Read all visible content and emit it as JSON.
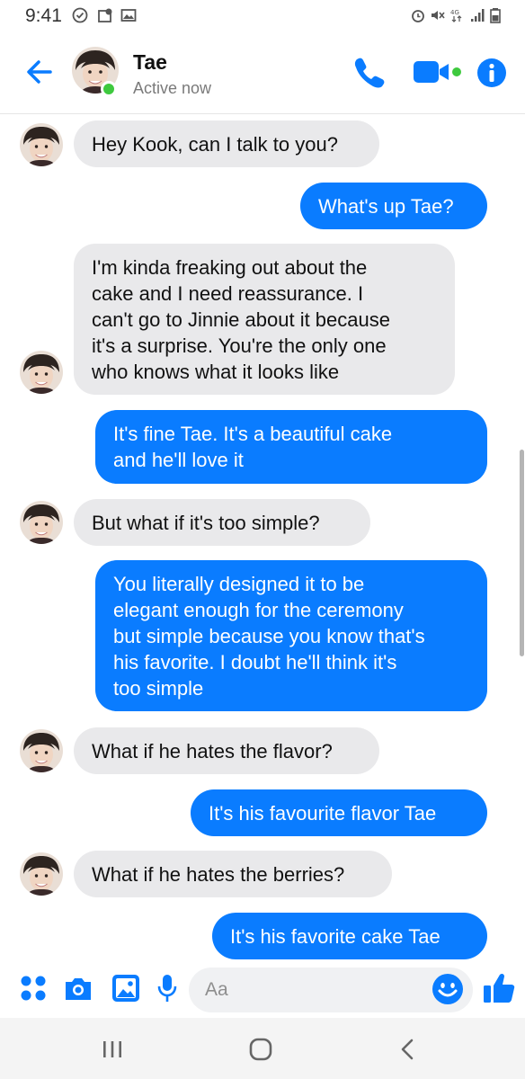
{
  "status_bar": {
    "time": "9:41",
    "icons": [
      "shield-check-icon",
      "location-tag-icon",
      "image-icon",
      "alarm-icon",
      "mute-icon",
      "data-4g-icon",
      "signal-icon",
      "battery-icon"
    ]
  },
  "header": {
    "contact_name": "Tae",
    "status": "Active now",
    "icons": [
      "back-arrow-icon",
      "phone-icon",
      "video-camera-icon",
      "info-icon"
    ],
    "accent_color": "#0a7cff",
    "online_color": "#3ec93e"
  },
  "messages": [
    {
      "from": "Tae",
      "direction": "incoming",
      "text": "Hey Kook, can I talk to you?"
    },
    {
      "from": "me",
      "direction": "outgoing",
      "text": "What's up Tae?"
    },
    {
      "from": "Tae",
      "direction": "incoming",
      "lines": [
        "I'm kinda freaking out about the",
        "cake and I need reassurance. I",
        "can't go to Jinnie about it because",
        "it's a surprise.  You're the only one",
        "who knows what it looks like"
      ]
    },
    {
      "from": "me",
      "direction": "outgoing",
      "lines": [
        "It's fine Tae. It's a beautiful cake",
        "and he'll love it"
      ]
    },
    {
      "from": "Tae",
      "direction": "incoming",
      "text": "But what if it's too simple?"
    },
    {
      "from": "me",
      "direction": "outgoing",
      "lines": [
        "You literally designed it to be",
        "elegant enough for the ceremony",
        "but simple because you know that's",
        "his favorite. I doubt he'll think it's",
        "too simple"
      ]
    },
    {
      "from": "Tae",
      "direction": "incoming",
      "text": "What if he hates the flavor?"
    },
    {
      "from": "me",
      "direction": "outgoing",
      "text": "It's his favourite flavor Tae"
    },
    {
      "from": "Tae",
      "direction": "incoming",
      "text": "What if he hates the berries?"
    },
    {
      "from": "me",
      "direction": "outgoing",
      "text": "It's his favorite cake Tae"
    }
  ],
  "composer": {
    "placeholder": "Aa",
    "icons": [
      "more-apps-icon",
      "camera-icon",
      "gallery-icon",
      "microphone-icon",
      "emoji-icon",
      "thumbs-up-icon"
    ]
  },
  "nav_bar": {
    "icons": [
      "recent-apps-icon",
      "home-icon",
      "back-icon"
    ]
  }
}
